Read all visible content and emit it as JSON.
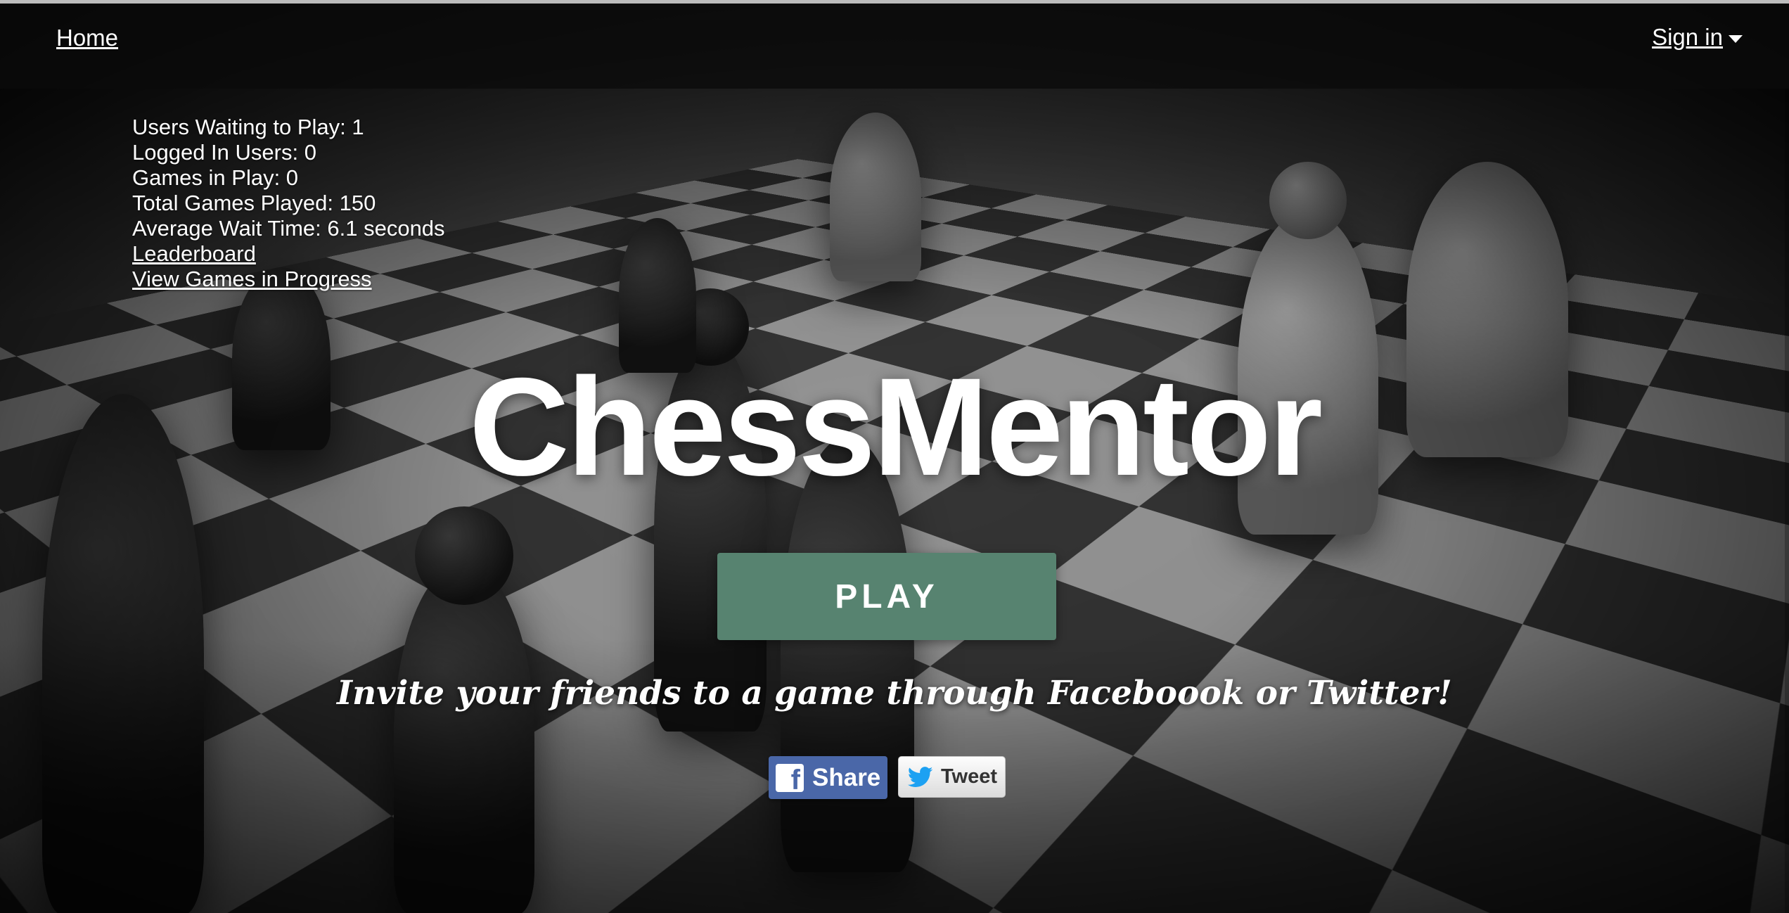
{
  "nav": {
    "home": "Home",
    "signin": "Sign in"
  },
  "stats": {
    "users_waiting": "Users Waiting to Play: 1",
    "logged_in": "Logged In Users: 0",
    "games_in_play": "Games in Play: 0",
    "total_games": "Total Games Played: 150",
    "avg_wait": "Average Wait Time: 6.1 seconds",
    "leaderboard": "Leaderboard",
    "view_games": "View Games in Progress"
  },
  "hero": {
    "title": "ChessMentor",
    "play": "PLAY",
    "invite": "Invite your friends to a game through Faceboook or Twitter!"
  },
  "social": {
    "share": "Share",
    "tweet": "Tweet",
    "facebook_color": "#4a67a8",
    "twitter_color": "#1da1f2"
  },
  "colors": {
    "play_button": "#578370",
    "topbar": "#0a0a0a"
  },
  "icons": {
    "signin_caret": "caret-down-icon",
    "facebook": "facebook-icon",
    "twitter": "twitter-bird-icon"
  }
}
